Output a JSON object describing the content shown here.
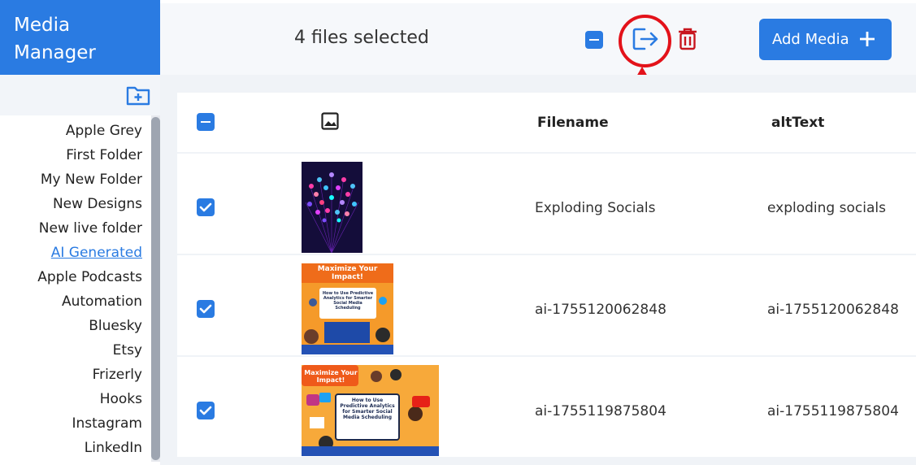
{
  "brand": {
    "line1": "Media",
    "line2": "Manager"
  },
  "sidebar": {
    "folders": [
      {
        "label": "Apple Grey",
        "active": false
      },
      {
        "label": "First Folder",
        "active": false
      },
      {
        "label": "My New Folder",
        "active": false
      },
      {
        "label": "New Designs",
        "active": false
      },
      {
        "label": "New live folder",
        "active": false
      },
      {
        "label": "AI Generated",
        "active": true
      },
      {
        "label": "Apple Podcasts",
        "active": false
      },
      {
        "label": "Automation",
        "active": false
      },
      {
        "label": "Bluesky",
        "active": false
      },
      {
        "label": "Etsy",
        "active": false
      },
      {
        "label": "Frizerly",
        "active": false
      },
      {
        "label": "Hooks",
        "active": false
      },
      {
        "label": "Instagram",
        "active": false
      },
      {
        "label": "LinkedIn",
        "active": false
      }
    ]
  },
  "toolbar": {
    "selection_text": "4 files selected",
    "add_media_label": "Add Media",
    "icons": [
      "deselect-all-icon",
      "move-to-folder-icon",
      "trash-icon",
      "plus-icon"
    ]
  },
  "table": {
    "headers": {
      "filename": "Filename",
      "alt": "altText"
    },
    "rows": [
      {
        "filename": "Exploding Socials",
        "alt": "exploding socials",
        "checked": true
      },
      {
        "filename": "ai-1755120062848",
        "alt": "ai-1755120062848",
        "checked": true,
        "thumb_title": "Maximize Your Impact!",
        "thumb_sub": "How to Use Predictive Analytics for Smarter Social Media Scheduling"
      },
      {
        "filename": "ai-1755119875804",
        "alt": "ai-1755119875804",
        "checked": true,
        "thumb_title": "Maximize Your Impact!",
        "thumb_sub": "How to Use Predictive Analytics for Smarter Social Media Scheduling"
      }
    ]
  },
  "colors": {
    "accent": "#2a7be2",
    "danger": "#c8161e",
    "annotation": "#e3121a"
  }
}
